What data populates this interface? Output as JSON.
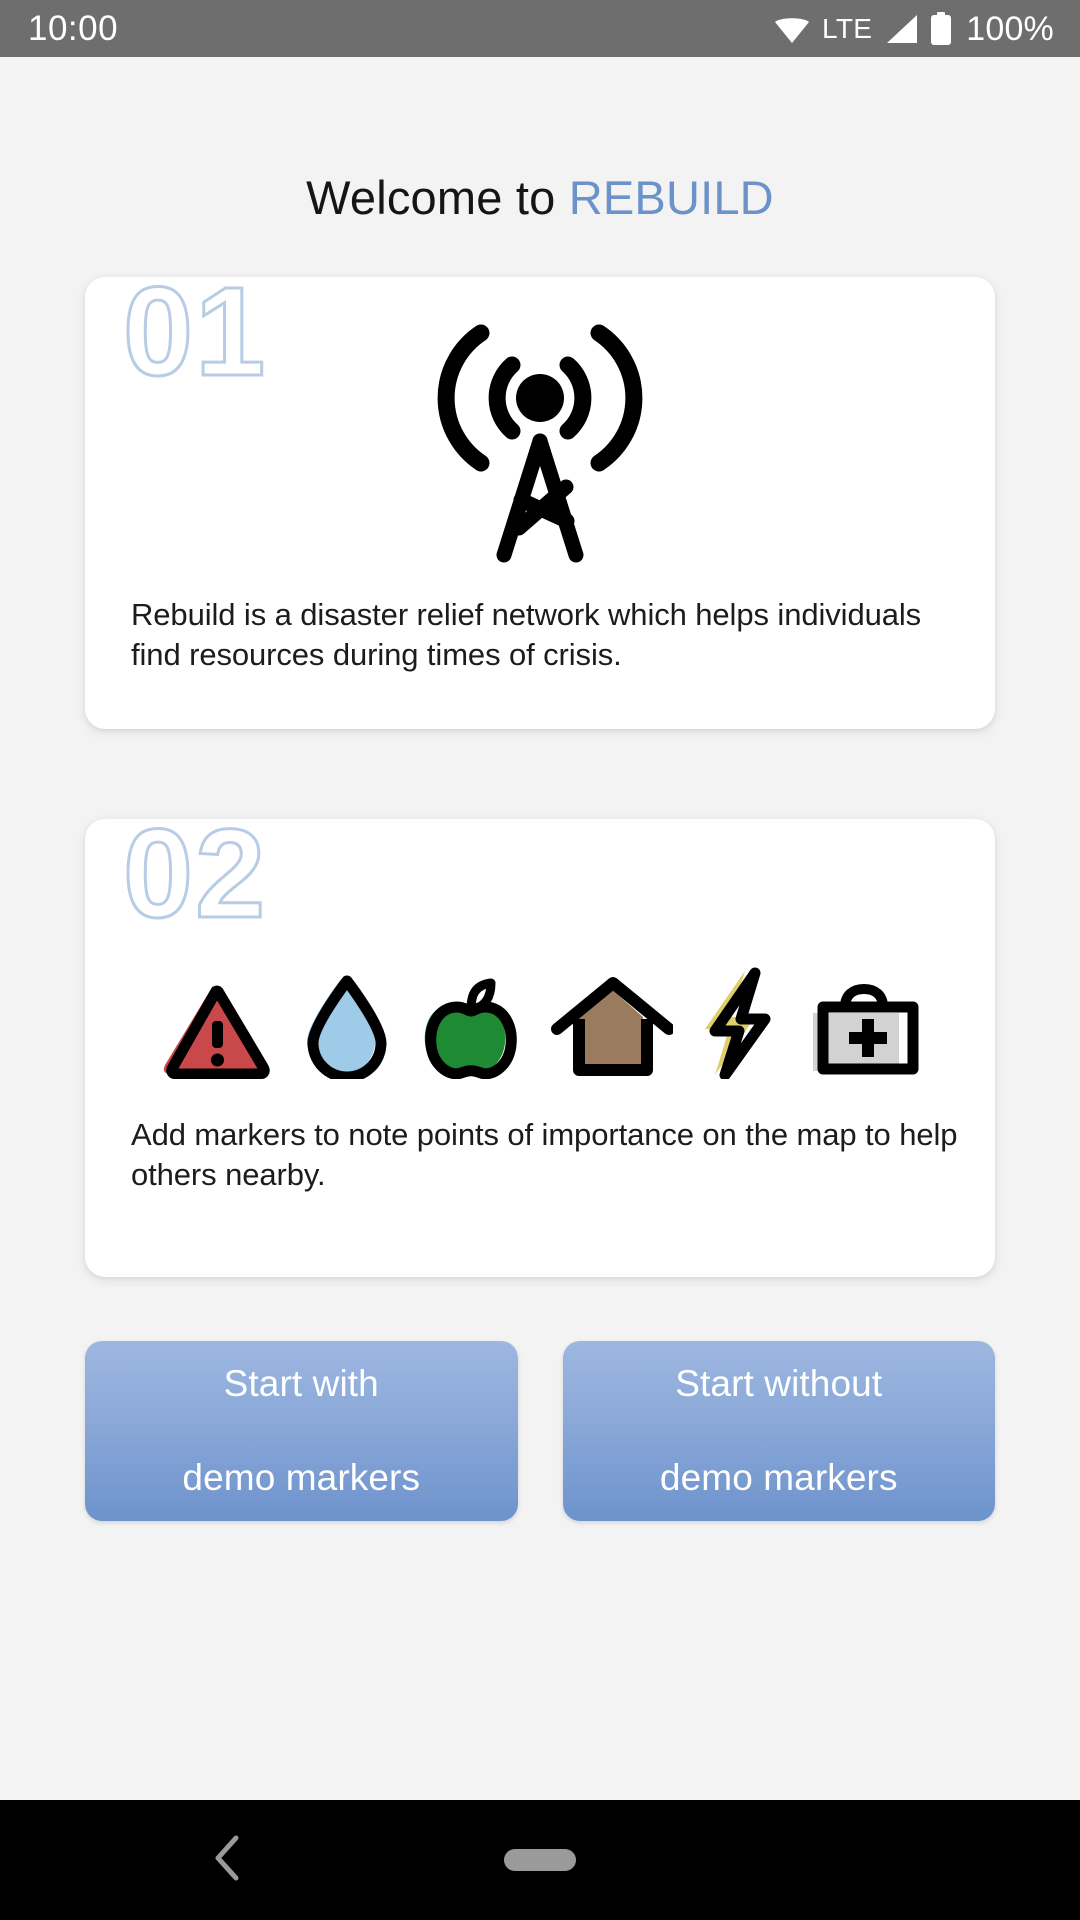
{
  "status_bar": {
    "clock": "10:00",
    "network_label": "LTE",
    "battery_percent": "100%",
    "icons": [
      "wifi-icon",
      "cellular-signal-icon",
      "battery-icon"
    ],
    "background_color": "#6e6e6e",
    "foreground_color": "#ffffff"
  },
  "header": {
    "title_plain": "Welcome to ",
    "title_brand": "REBUILD",
    "brand_color": "#6b92c9"
  },
  "cards": [
    {
      "number": "01",
      "number_stroke_color": "#b9cce6",
      "illustration": "broadcast-tower-icon",
      "description": "Rebuild is a disaster relief network which helps individuals find resources during times of crisis."
    },
    {
      "number": "02",
      "number_stroke_color": "#b9cce6",
      "illustration": "marker-type-row",
      "markers": [
        {
          "name": "warning-triangle-icon",
          "label": "Hazard",
          "color": "#c9484a"
        },
        {
          "name": "water-drop-icon",
          "label": "Water",
          "color": "#9ecbe8"
        },
        {
          "name": "apple-food-icon",
          "label": "Food",
          "color": "#1f8a34"
        },
        {
          "name": "house-shelter-icon",
          "label": "Shelter",
          "color": "#9a7b5e"
        },
        {
          "name": "lightning-bolt-icon",
          "label": "Power",
          "color": "#ddd06a"
        },
        {
          "name": "first-aid-kit-icon",
          "label": "Medical",
          "color": "#d2d2d2"
        }
      ],
      "description": "Add markers to note points of importance on the map to help others nearby."
    }
  ],
  "buttons": [
    {
      "line1": "Start with",
      "line2": "demo markers"
    },
    {
      "line1": "Start without",
      "line2": "demo markers"
    }
  ],
  "nav_bar": {
    "back_icon": "chevron-left-icon",
    "home_pill": "home-pill-handle",
    "background_color": "#000000",
    "icon_color": "#9a9a9a"
  },
  "theme": {
    "page_background": "#f3f3f3",
    "card_background": "#ffffff",
    "accent_blue": "#6b92c9",
    "button_gradient_top": "#9db7e0",
    "button_gradient_bottom": "#6d93cc"
  }
}
